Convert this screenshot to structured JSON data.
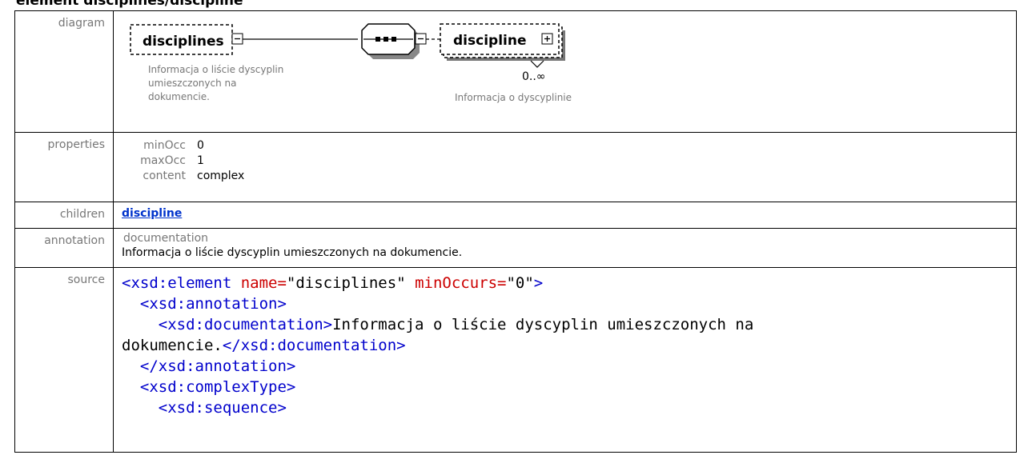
{
  "header": {
    "title": "element disciplines/discipline"
  },
  "rows": {
    "diagram": {
      "label": "diagram",
      "element_name": "disciplines",
      "element_doc": [
        "Informacja o liście dyscyplin",
        "umieszczonych na",
        "dokumencie."
      ],
      "child_name": "discipline",
      "child_occurs": "0..∞",
      "child_doc": "Informacja o dyscyplinie"
    },
    "properties": {
      "label": "properties",
      "items": [
        {
          "key": "minOcc",
          "value": "0"
        },
        {
          "key": "maxOcc",
          "value": "1"
        },
        {
          "key": "content",
          "value": "complex"
        }
      ]
    },
    "children": {
      "label": "children",
      "link": "discipline"
    },
    "annotation": {
      "label": "annotation",
      "heading": "documentation",
      "text": "Informacja o liście dyscyplin umieszczonych na dokumencie."
    },
    "source": {
      "label": "source",
      "lines": [
        [
          {
            "t": "tag",
            "s": "<xsd:element "
          },
          {
            "t": "att",
            "s": "name="
          },
          {
            "t": "txt",
            "s": "\"disciplines\" "
          },
          {
            "t": "att",
            "s": "minOccurs="
          },
          {
            "t": "txt",
            "s": "\"0\""
          },
          {
            "t": "tag",
            "s": ">"
          }
        ],
        [
          {
            "t": "txt",
            "s": "  "
          },
          {
            "t": "tag",
            "s": "<xsd:annotation>"
          }
        ],
        [
          {
            "t": "txt",
            "s": "    "
          },
          {
            "t": "tag",
            "s": "<xsd:documentation>"
          },
          {
            "t": "txt",
            "s": "Informacja o liście dyscyplin umieszczonych na"
          }
        ],
        [
          {
            "t": "txt",
            "s": "dokumencie."
          },
          {
            "t": "tag",
            "s": "</xsd:documentation>"
          }
        ],
        [
          {
            "t": "txt",
            "s": "  "
          },
          {
            "t": "tag",
            "s": "</xsd:annotation>"
          }
        ],
        [
          {
            "t": "txt",
            "s": "  "
          },
          {
            "t": "tag",
            "s": "<xsd:complexType>"
          }
        ],
        [
          {
            "t": "txt",
            "s": "    "
          },
          {
            "t": "tag",
            "s": "<xsd:sequence>"
          }
        ]
      ]
    }
  },
  "colors": {
    "label_gray": "#777777",
    "link_blue": "#0033cc",
    "tag_blue": "#0000cc",
    "attr_red": "#cc0000"
  }
}
